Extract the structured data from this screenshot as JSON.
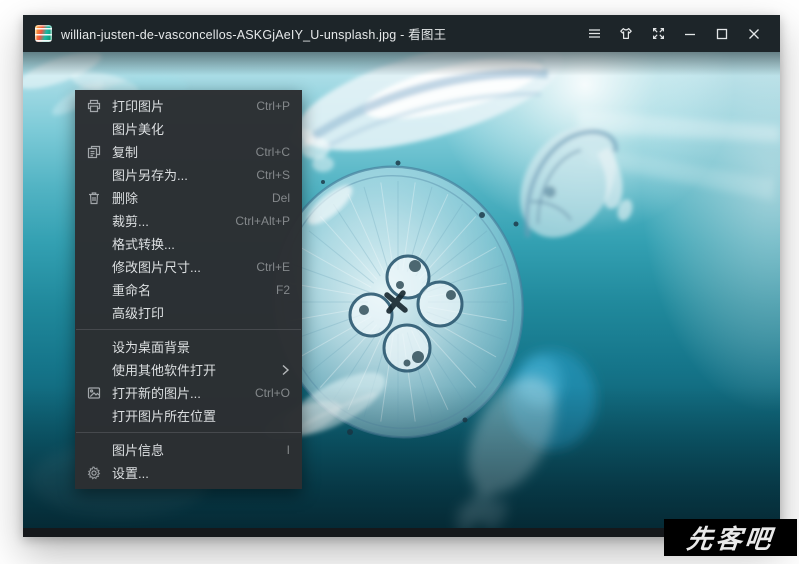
{
  "window": {
    "title": "willian-justen-de-vasconcellos-ASKGjAeIY_U-unsplash.jpg - 看图王",
    "app_name": "看图王",
    "controls": [
      {
        "id": "main-menu",
        "icon": "hamburger-icon"
      },
      {
        "id": "skin",
        "icon": "tshirt-icon"
      },
      {
        "id": "fullscreen",
        "icon": "expand-icon"
      },
      {
        "id": "minimize",
        "icon": "minimize-icon"
      },
      {
        "id": "maximize",
        "icon": "maximize-icon"
      },
      {
        "id": "close",
        "icon": "close-icon"
      }
    ]
  },
  "context_menu": {
    "items": [
      {
        "id": "print-image",
        "label": "打印图片",
        "shortcut": "Ctrl+P",
        "icon": "printer-icon"
      },
      {
        "id": "beautify",
        "label": "图片美化",
        "shortcut": ""
      },
      {
        "id": "copy",
        "label": "复制",
        "shortcut": "Ctrl+C",
        "icon": "copy-icon"
      },
      {
        "id": "save-as",
        "label": "图片另存为...",
        "shortcut": "Ctrl+S"
      },
      {
        "id": "delete",
        "label": "删除",
        "shortcut": "Del",
        "icon": "trash-icon"
      },
      {
        "id": "crop",
        "label": "裁剪...",
        "shortcut": "Ctrl+Alt+P"
      },
      {
        "id": "format-convert",
        "label": "格式转换...",
        "shortcut": ""
      },
      {
        "id": "resize-image",
        "label": "修改图片尺寸...",
        "shortcut": "Ctrl+E"
      },
      {
        "id": "rename",
        "label": "重命名",
        "shortcut": "F2"
      },
      {
        "id": "advanced-print",
        "label": "高级打印",
        "shortcut": ""
      },
      {
        "type": "separator"
      },
      {
        "id": "set-wallpaper",
        "label": "设为桌面背景",
        "shortcut": ""
      },
      {
        "id": "open-with",
        "label": "使用其他软件打开",
        "shortcut": "",
        "has_submenu": true
      },
      {
        "id": "open-new-image",
        "label": "打开新的图片...",
        "shortcut": "Ctrl+O",
        "icon": "image-icon"
      },
      {
        "id": "open-location",
        "label": "打开图片所在位置",
        "shortcut": ""
      },
      {
        "type": "separator"
      },
      {
        "id": "image-info",
        "label": "图片信息",
        "shortcut": "I"
      },
      {
        "id": "settings",
        "label": "设置...",
        "shortcut": "",
        "icon": "gear-icon"
      }
    ]
  },
  "watermark": {
    "text": "先客吧"
  },
  "colors": {
    "titlebar_bg": "#1d2529",
    "menu_bg": "#2c2f32",
    "menu_text": "#dcdfe1",
    "menu_shortcut": "#84888b",
    "photo_top": "#b9e4eb",
    "photo_mid": "#20899c",
    "photo_bottom": "#07404f",
    "watermark_bg": "#000000"
  }
}
